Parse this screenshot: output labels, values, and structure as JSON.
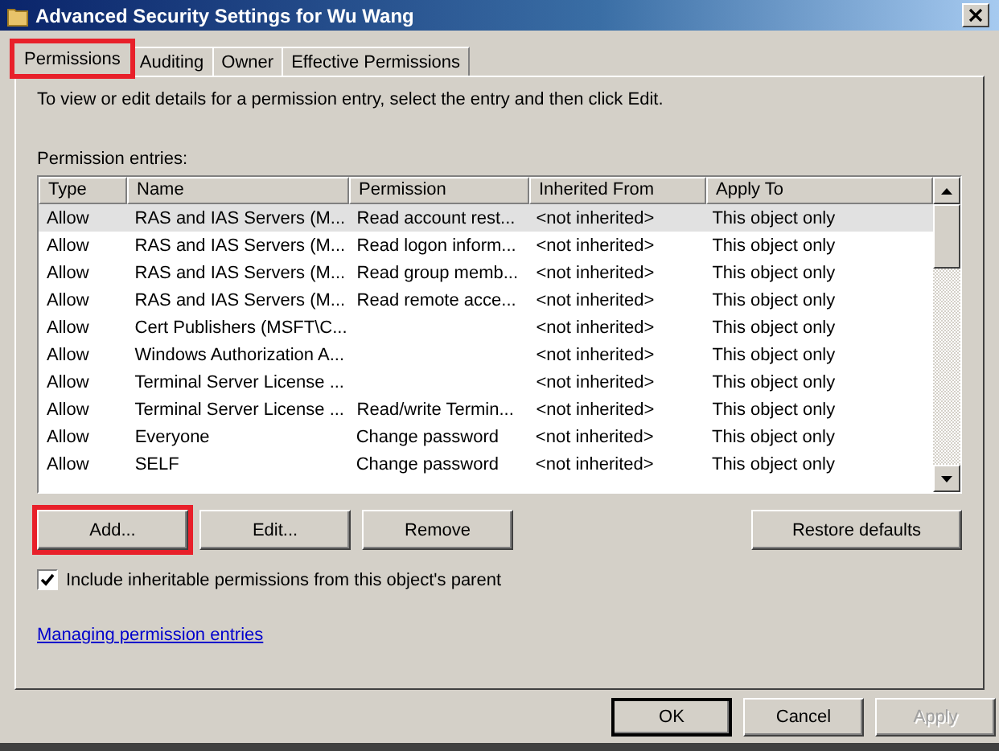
{
  "window": {
    "title": "Advanced Security Settings for Wu Wang"
  },
  "tabs": [
    {
      "label": "Permissions",
      "selected": true,
      "highlighted": true
    },
    {
      "label": "Auditing",
      "selected": false,
      "highlighted": false
    },
    {
      "label": "Owner",
      "selected": false,
      "highlighted": false
    },
    {
      "label": "Effective Permissions",
      "selected": false,
      "highlighted": false
    }
  ],
  "instructions": "To view or edit details for a permission entry, select the entry and then click Edit.",
  "entries_label": "Permission entries:",
  "table": {
    "columns": [
      "Type",
      "Name",
      "Permission",
      "Inherited From",
      "Apply To"
    ],
    "rows": [
      {
        "selected": true,
        "cells": [
          "Allow",
          "RAS and IAS Servers (M...",
          "Read account rest...",
          "<not inherited>",
          "This object only"
        ]
      },
      {
        "selected": false,
        "cells": [
          "Allow",
          "RAS and IAS Servers (M...",
          "Read logon inform...",
          "<not inherited>",
          "This object only"
        ]
      },
      {
        "selected": false,
        "cells": [
          "Allow",
          "RAS and IAS Servers (M...",
          "Read group memb...",
          "<not inherited>",
          "This object only"
        ]
      },
      {
        "selected": false,
        "cells": [
          "Allow",
          "RAS and IAS Servers (M...",
          "Read remote acce...",
          "<not inherited>",
          "This object only"
        ]
      },
      {
        "selected": false,
        "cells": [
          "Allow",
          "Cert Publishers (MSFT\\C...",
          "",
          "<not inherited>",
          "This object only"
        ]
      },
      {
        "selected": false,
        "cells": [
          "Allow",
          "Windows Authorization A...",
          "",
          "<not inherited>",
          "This object only"
        ]
      },
      {
        "selected": false,
        "cells": [
          "Allow",
          "Terminal Server License ...",
          "",
          "<not inherited>",
          "This object only"
        ]
      },
      {
        "selected": false,
        "cells": [
          "Allow",
          "Terminal Server License ...",
          "Read/write Termin...",
          "<not inherited>",
          "This object only"
        ]
      },
      {
        "selected": false,
        "cells": [
          "Allow",
          "Everyone",
          "Change password",
          "<not inherited>",
          "This object only"
        ]
      },
      {
        "selected": false,
        "cells": [
          "Allow",
          "SELF",
          "Change password",
          "<not inherited>",
          "This object only"
        ]
      }
    ]
  },
  "entry_buttons": [
    {
      "label": "Add...",
      "highlighted": true
    },
    {
      "label": "Edit...",
      "highlighted": false
    },
    {
      "label": "Remove",
      "highlighted": false
    }
  ],
  "restore_button": {
    "label": "Restore defaults"
  },
  "inherit_checkbox": {
    "label": "Include inheritable permissions from this object's parent",
    "checked": true
  },
  "help_link": "Managing permission entries",
  "dialog_buttons": [
    {
      "label": "OK",
      "default": true,
      "disabled": false
    },
    {
      "label": "Cancel",
      "default": false,
      "disabled": false
    },
    {
      "label": "Apply",
      "default": false,
      "disabled": true
    }
  ]
}
